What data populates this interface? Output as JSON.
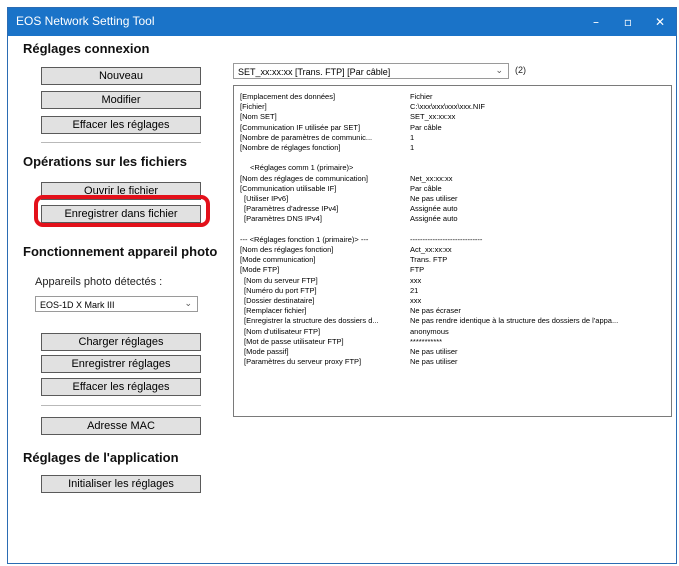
{
  "window": {
    "title": "EOS Network Setting Tool",
    "controls": {
      "minimize": "–",
      "maximize": "▫",
      "close": "✕"
    }
  },
  "sections": {
    "connexion": "Réglages connexion",
    "fichiers": "Opérations sur les fichiers",
    "appareil": "Fonctionnement appareil photo",
    "application": "Réglages de l'application"
  },
  "buttons": {
    "nouveau": "Nouveau",
    "modifier": "Modifier",
    "effacer": "Effacer les réglages",
    "ouvrir": "Ouvrir le fichier",
    "enregistrer_fichier": "Enregistrer dans fichier",
    "charger": "Charger réglages",
    "enregistrer_reglages": "Enregistrer réglages",
    "effacer_reglages": "Effacer les réglages",
    "adresse_mac": "Adresse MAC",
    "initialiser": "Initialiser les réglages"
  },
  "camera": {
    "label": "Appareils photo détectés :",
    "selected": "EOS-1D X Mark III"
  },
  "set_combo": {
    "selected": "SET_xx:xx:xx [Trans. FTP] [Par câble]",
    "count": "(2)"
  },
  "details": [
    {
      "k": "[Emplacement des données]",
      "v": "Fichier"
    },
    {
      "k": "[Fichier]",
      "v": "C:\\xxx\\xxx\\xxx\\xxx.NIF"
    },
    {
      "k": "[Nom SET]",
      "v": "SET_xx:xx:xx"
    },
    {
      "k": "[Communication IF utilisée par SET]",
      "v": "Par câble"
    },
    {
      "k": "[Nombre de paramètres de communic...",
      "v": "1"
    },
    {
      "k": "[Nombre de réglages fonction]",
      "v": "1"
    },
    {
      "k": "",
      "v": ""
    },
    {
      "k": "<Réglages comm 1 (primaire)>",
      "v": "",
      "indent": 10
    },
    {
      "k": "[Nom des réglages de communication]",
      "v": "Net_xx:xx:xx"
    },
    {
      "k": "[Communication utilisable IF]",
      "v": "Par câble"
    },
    {
      "k": "[Utiliser IPv6]",
      "v": "Ne pas utiliser",
      "indent": 4
    },
    {
      "k": "[Paramètres d'adresse IPv4]",
      "v": "Assignée auto",
      "indent": 4
    },
    {
      "k": "[Paramètres DNS IPv4]",
      "v": "Assignée auto",
      "indent": 4
    },
    {
      "k": "",
      "v": ""
    },
    {
      "k": "--- <Réglages fonction 1 (primaire)> ---",
      "v": "-----------------------------"
    },
    {
      "k": "[Nom des réglages fonction]",
      "v": "Act_xx:xx:xx"
    },
    {
      "k": "[Mode communication]",
      "v": "Trans. FTP"
    },
    {
      "k": "[Mode FTP]",
      "v": "FTP"
    },
    {
      "k": "[Nom du serveur FTP]",
      "v": "xxx",
      "indent": 4
    },
    {
      "k": "[Numéro du port FTP]",
      "v": "21",
      "indent": 4
    },
    {
      "k": "[Dossier destinataire]",
      "v": "xxx",
      "indent": 4
    },
    {
      "k": "[Remplacer fichier]",
      "v": "Ne pas écraser",
      "indent": 4
    },
    {
      "k": "[Enregistrer la structure des dossiers d...",
      "v": "Ne pas rendre identique à la structure des dossiers de l'appa...",
      "indent": 4
    },
    {
      "k": "[Nom d'utilisateur FTP]",
      "v": "anonymous",
      "indent": 4
    },
    {
      "k": "[Mot de passe utilisateur FTP]",
      "v": "***********",
      "indent": 4
    },
    {
      "k": "[Mode passif]",
      "v": "Ne pas utiliser",
      "indent": 4
    },
    {
      "k": "[Paramètres du serveur proxy FTP]",
      "v": "Ne pas utiliser",
      "indent": 4
    }
  ],
  "colors": {
    "titlebar": "#1a73c8",
    "highlight": "#e3101a",
    "button_face": "#e1e1e1"
  }
}
